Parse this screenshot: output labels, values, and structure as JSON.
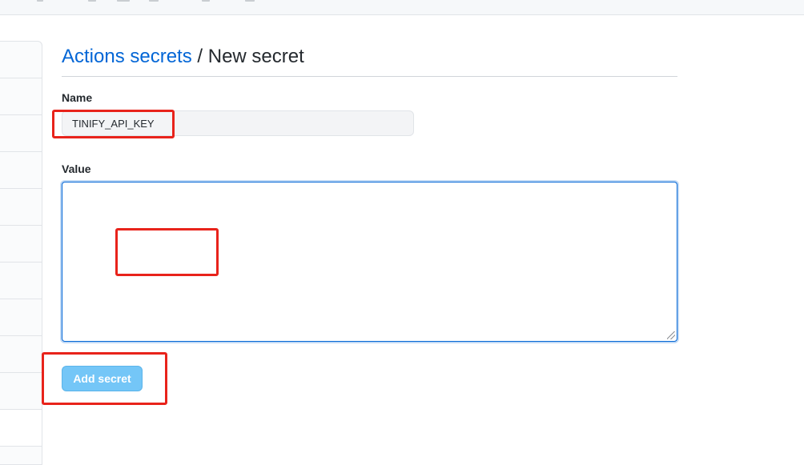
{
  "breadcrumb": {
    "parent": "Actions secrets",
    "separator": " / ",
    "current": "New secret"
  },
  "form": {
    "name_label": "Name",
    "name_value": "TINIFY_API_KEY",
    "value_label": "Value",
    "value_text": ""
  },
  "actions": {
    "submit_label": "Add secret"
  },
  "colors": {
    "link": "#0366d6",
    "button_disabled": "#74c6f7",
    "annotation": "#e8231b"
  }
}
